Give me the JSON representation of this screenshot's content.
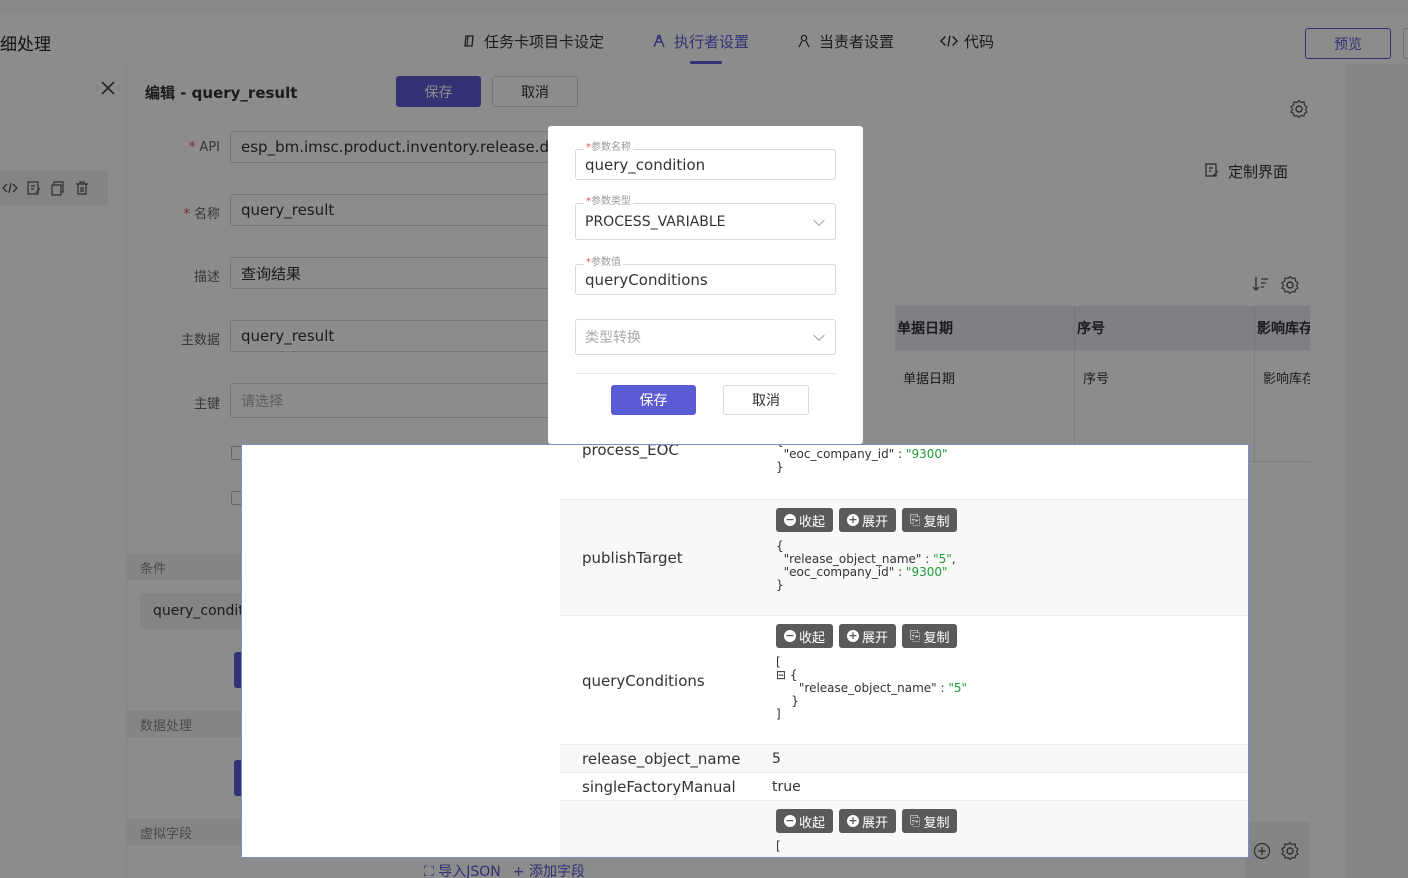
{
  "page": {
    "title": "细处理"
  },
  "tabs": [
    {
      "label": "任务卡项目卡设定",
      "icon": "card-icon",
      "active": false
    },
    {
      "label": "执行者设置",
      "icon": "executor-icon",
      "active": true
    },
    {
      "label": "当责者设置",
      "icon": "person-icon",
      "active": false
    },
    {
      "label": "代码",
      "icon": "code-icon",
      "active": false
    }
  ],
  "header": {
    "preview_label": "预览"
  },
  "editor": {
    "title": "编辑 - query_result",
    "save_label": "保存",
    "cancel_label": "取消",
    "fields": {
      "api_label": "API",
      "api_value": "esp_bm.imsc.product.inventory.release.d...",
      "name_label": "名称",
      "name_value": "query_result",
      "desc_label": "描述",
      "desc_value": "查询结果",
      "master_label": "主数据",
      "master_value": "query_result",
      "key_label": "主键",
      "key_placeholder": "请选择"
    },
    "sections": {
      "condition": "条件",
      "condition_chip": "query_conditi",
      "data_processing": "数据处理",
      "virtual_fields": "虚拟字段"
    },
    "bottom_links": {
      "import_json": "导入JSON",
      "add_field": "+ 添加字段"
    }
  },
  "right_panel": {
    "custom_ui_label": "定制界面",
    "table": {
      "headers": [
        "单据日期",
        "序号",
        "影响库存"
      ],
      "row": [
        "单据日期",
        "序号",
        "影响库存"
      ]
    }
  },
  "json_viewer": {
    "buttons": {
      "collapse": "收起",
      "expand": "展开",
      "copy": "复制"
    },
    "rows": [
      {
        "key": "process_EOC",
        "code_lines": [
          "{",
          "  \"eoc_company_id\" : \"9300\"",
          "}"
        ]
      },
      {
        "key": "publishTarget",
        "code_lines": [
          "{",
          "  \"release_object_name\" : \"5\",",
          "  \"eoc_company_id\" : \"9300\"",
          "}"
        ]
      },
      {
        "key": "queryConditions",
        "code_lines": [
          "[",
          "  {",
          "    \"release_object_name\" : \"5\"",
          "  }",
          "]"
        ]
      },
      {
        "key": "release_object_name",
        "value": "5"
      },
      {
        "key": "singleFactoryManual",
        "value": "true"
      },
      {
        "key": "",
        "code_lines": [
          "["
        ]
      }
    ]
  },
  "modal": {
    "param_name_label": "参数名称",
    "param_name_value": "query_condition",
    "param_type_label": "参数类型",
    "param_type_value": "PROCESS_VARIABLE",
    "param_value_label": "参数值",
    "param_value_value": "queryConditions",
    "type_convert_placeholder": "类型转换",
    "save_label": "保存",
    "cancel_label": "取消"
  },
  "colors": {
    "accent": "#5b5bd6",
    "json_string": "#219b3a",
    "required": "#e34d59"
  }
}
